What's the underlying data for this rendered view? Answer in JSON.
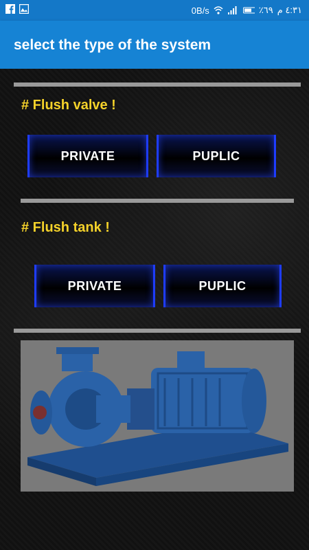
{
  "status_bar": {
    "network_speed": "0B/s",
    "battery": "٪٦٩",
    "time": "٤:٣١ م",
    "icons": [
      "facebook-icon",
      "gallery-icon",
      "wifi-icon",
      "signal-icon",
      "battery-icon"
    ]
  },
  "app_bar": {
    "title": "select the type of the system"
  },
  "sections": [
    {
      "title": "# Flush valve !",
      "buttons": [
        "PRIVATE",
        "PUPLIC"
      ]
    },
    {
      "title": "# Flush tank !",
      "buttons": [
        "PRIVATE",
        "PUPLIC"
      ]
    }
  ],
  "colors": {
    "status_bar": "#1478c8",
    "app_bar": "#1683d4",
    "section_title": "#f5d22a",
    "button_border": "#1e3cff",
    "pump": "#2a62a8",
    "image_background": "#7a7a7a"
  }
}
